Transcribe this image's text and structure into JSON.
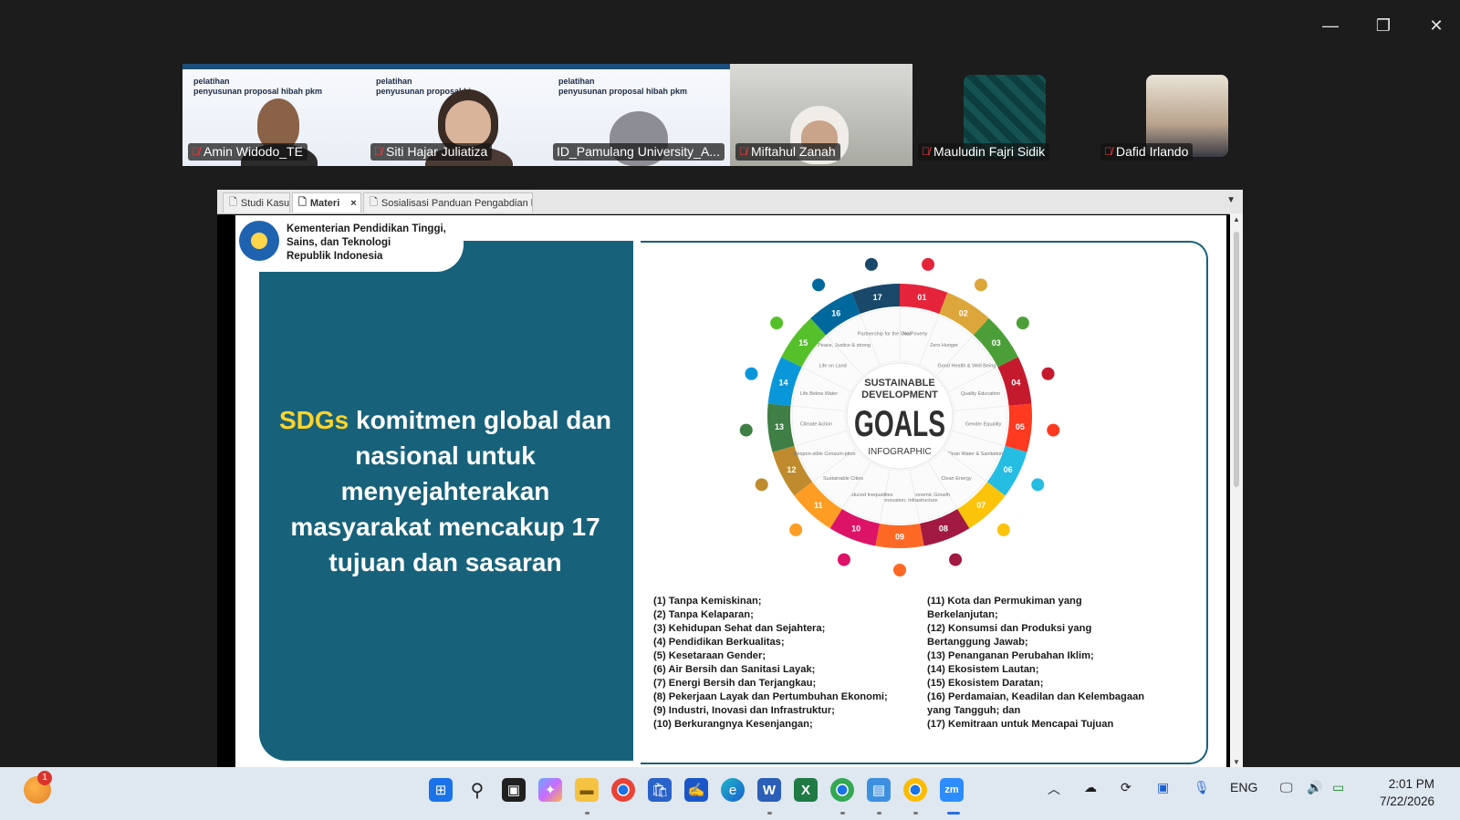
{
  "window": {
    "minimize_icon": "minimize-icon",
    "restore_icon": "restore-icon",
    "close_icon": "close-icon"
  },
  "participants": [
    {
      "name": "Amin Widodo_TE",
      "muted": true,
      "thumb_title": "pelatihan",
      "thumb_sub": "penyusunan proposal hibah pkm"
    },
    {
      "name": "Siti Hajar Juliatiza",
      "muted": true,
      "thumb_title": "pelatihan",
      "thumb_sub": "penyusunan proposal hi"
    },
    {
      "name": "ID_Pamulang University_A...",
      "muted": false,
      "active": true,
      "thumb_title": "pelatihan",
      "thumb_sub": "penyusunan proposal hibah pkm"
    },
    {
      "name": "Miftahul Zanah",
      "muted": true
    },
    {
      "name": "Mauludin Fajri Sidik",
      "muted": true
    },
    {
      "name": "Dafid Irlando",
      "muted": true
    }
  ],
  "tabs": [
    {
      "label": "Studi Kasus",
      "selected": false
    },
    {
      "label": "Materi",
      "selected": true,
      "close": "×"
    },
    {
      "label": "Sosialisasi Panduan Pengabdian ke...",
      "selected": false
    }
  ],
  "slide": {
    "org_lines": [
      "Kementerian Pendidikan Tinggi,",
      "Sains, dan Teknologi",
      "Republik Indonesia"
    ],
    "headline_highlight": "SDGs",
    "headline_rest": " komitmen global dan nasional untuk menyejahterakan masyarakat mencakup 17 tujuan dan sasaran",
    "sdg_center": {
      "line1": "SUSTAINABLE",
      "line2": "DEVELOPMENT",
      "big": "GOALS",
      "sub": "INFOGRAPHIC"
    },
    "sdg_numbers": [
      "01",
      "02",
      "03",
      "04",
      "05",
      "06",
      "07",
      "08",
      "09",
      "10",
      "11",
      "12",
      "13",
      "14",
      "15",
      "16",
      "17"
    ],
    "sdg_labels": [
      "No Poverty",
      "Zero Hunger",
      "Good Health & Well Being",
      "Quality Education",
      "Gender Equality",
      "Clean Water & Sanitation",
      "Clean Energy",
      "Economic Growth",
      "Industry, Innovation, Infrastructure",
      "Reduced Inequalities",
      "Sustainable Cities",
      "Respon-sible Consum-ption",
      "Climate Action",
      "Life Below Water",
      "Life on Land",
      "Peace, Justice & strong Institution",
      "Partnership for the Goal"
    ],
    "sdg_colors": [
      "#e5243b",
      "#dda63a",
      "#4c9f38",
      "#c5192d",
      "#ff3a21",
      "#26bde2",
      "#fcc30b",
      "#a21942",
      "#fd6925",
      "#dd1367",
      "#fd9d24",
      "#bf8b2e",
      "#3f7e44",
      "#0a97d9",
      "#56c02b",
      "#00689d",
      "#19486a"
    ],
    "list_left": [
      "(1) Tanpa Kemiskinan;",
      "(2) Tanpa Kelaparan;",
      "(3) Kehidupan Sehat dan Sejahtera;",
      "(4) Pendidikan Berkualitas;",
      "(5) Kesetaraan Gender;",
      "(6) Air Bersih dan Sanitasi Layak;",
      "(7) Energi Bersih dan Terjangkau;",
      "(8) Pekerjaan Layak dan Pertumbuhan Ekonomi;",
      "(9) Industri, Inovasi dan Infrastruktur;",
      "(10) Berkurangnya Kesenjangan;"
    ],
    "list_right": [
      "(11) Kota dan Permukiman yang",
      "Berkelanjutan;",
      "(12) Konsumsi dan Produksi yang",
      "Bertanggung Jawab;",
      "(13) Penanganan Perubahan Iklim;",
      "(14) Ekosistem Lautan;",
      "(15) Ekosistem Daratan;",
      "(16) Perdamaian, Keadilan dan Kelembagaan",
      "yang Tangguh; dan",
      "(17) Kemitraan untuk Mencapai Tujuan"
    ]
  },
  "taskbar": {
    "weather_badge": "1",
    "apps": [
      "windows-start-icon",
      "search-icon",
      "task-view-icon",
      "copilot-icon",
      "file-explorer-icon",
      "chrome-icon",
      "store-icon",
      "pen-app-icon",
      "edge-icon",
      "word-icon",
      "excel-icon",
      "chrome-profile-icon",
      "notepad-icon",
      "chrome-alt-icon",
      "zoom-icon"
    ],
    "tray_lang": "ENG",
    "time": "2:01 PM",
    "date": "7/22/2026"
  }
}
